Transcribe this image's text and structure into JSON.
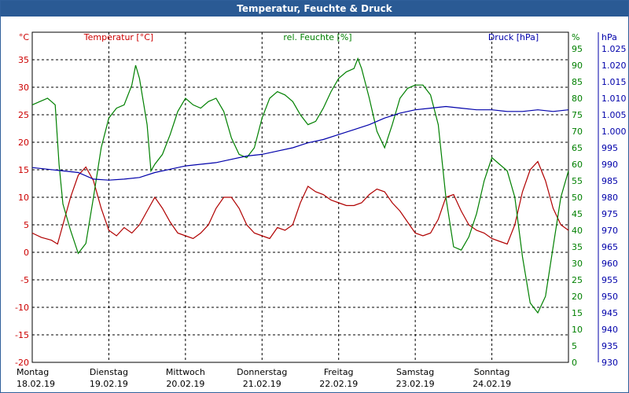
{
  "window": {
    "title": "Temperatur, Feuchte & Druck"
  },
  "chart_data": {
    "type": "line",
    "title": "Temperatur, Feuchte & Druck",
    "axes": {
      "left": {
        "unit": "°C",
        "label": "Temperatur [°C]",
        "range": [
          -20,
          40
        ],
        "ticks": [
          -20,
          -15,
          -10,
          -5,
          0,
          5,
          10,
          15,
          20,
          25,
          30,
          35
        ],
        "color": "#cc0000"
      },
      "right1": {
        "unit": "%",
        "label": "rel. Feuchte [%]",
        "range": [
          0,
          100
        ],
        "ticks": [
          0,
          5,
          10,
          15,
          20,
          25,
          30,
          35,
          40,
          45,
          50,
          55,
          60,
          65,
          70,
          75,
          80,
          85,
          90,
          95
        ],
        "color": "#008000"
      },
      "right2": {
        "unit": "hPa",
        "label": "Druck [hPa]",
        "range": [
          930,
          1030
        ],
        "ticks": [
          "930",
          "935",
          "940",
          "945",
          "950",
          "955",
          "960",
          "965",
          "970",
          "975",
          "980",
          "985",
          "990",
          "995",
          "1.000",
          "1.005",
          "1.010",
          "1.015",
          "1.020",
          "1.025"
        ],
        "color": "#0000aa"
      }
    },
    "x": {
      "range": [
        0,
        7
      ],
      "ticks": [
        {
          "day": "Montag",
          "date": "18.02.19"
        },
        {
          "day": "Dienstag",
          "date": "19.02.19"
        },
        {
          "day": "Mittwoch",
          "date": "20.02.19"
        },
        {
          "day": "Donnerstag",
          "date": "21.02.19"
        },
        {
          "day": "Freitag",
          "date": "22.02.19"
        },
        {
          "day": "Samstag",
          "date": "23.02.19"
        },
        {
          "day": "Sonntag",
          "date": "24.02.19"
        }
      ]
    },
    "grid": true,
    "series": [
      {
        "name": "Temperatur [°C]",
        "axis": "left",
        "color": "#b00000",
        "points": [
          [
            0.0,
            3.5
          ],
          [
            0.12,
            2.7
          ],
          [
            0.25,
            2.2
          ],
          [
            0.33,
            1.5
          ],
          [
            0.4,
            5.0
          ],
          [
            0.5,
            10.0
          ],
          [
            0.6,
            14.0
          ],
          [
            0.7,
            15.5
          ],
          [
            0.8,
            13.0
          ],
          [
            0.9,
            8.0
          ],
          [
            1.0,
            4.0
          ],
          [
            1.1,
            3.0
          ],
          [
            1.2,
            4.5
          ],
          [
            1.3,
            3.5
          ],
          [
            1.4,
            5.0
          ],
          [
            1.5,
            7.5
          ],
          [
            1.6,
            10.0
          ],
          [
            1.7,
            8.0
          ],
          [
            1.8,
            5.5
          ],
          [
            1.9,
            3.5
          ],
          [
            2.0,
            3.0
          ],
          [
            2.1,
            2.5
          ],
          [
            2.2,
            3.5
          ],
          [
            2.3,
            5.0
          ],
          [
            2.4,
            8.0
          ],
          [
            2.5,
            10.0
          ],
          [
            2.6,
            10.0
          ],
          [
            2.7,
            8.0
          ],
          [
            2.8,
            5.0
          ],
          [
            2.9,
            3.5
          ],
          [
            3.0,
            3.0
          ],
          [
            3.1,
            2.5
          ],
          [
            3.2,
            4.5
          ],
          [
            3.3,
            4.0
          ],
          [
            3.4,
            5.0
          ],
          [
            3.5,
            9.0
          ],
          [
            3.6,
            12.0
          ],
          [
            3.7,
            11.0
          ],
          [
            3.8,
            10.5
          ],
          [
            3.9,
            9.5
          ],
          [
            4.0,
            9.0
          ],
          [
            4.1,
            8.5
          ],
          [
            4.2,
            8.5
          ],
          [
            4.3,
            9.0
          ],
          [
            4.4,
            10.5
          ],
          [
            4.5,
            11.5
          ],
          [
            4.6,
            11.0
          ],
          [
            4.7,
            9.0
          ],
          [
            4.8,
            7.5
          ],
          [
            4.9,
            5.5
          ],
          [
            5.0,
            3.5
          ],
          [
            5.1,
            3.0
          ],
          [
            5.2,
            3.5
          ],
          [
            5.3,
            6.0
          ],
          [
            5.4,
            10.0
          ],
          [
            5.5,
            10.5
          ],
          [
            5.6,
            7.5
          ],
          [
            5.7,
            5.0
          ],
          [
            5.8,
            4.0
          ],
          [
            5.9,
            3.5
          ],
          [
            6.0,
            2.5
          ],
          [
            6.1,
            2.0
          ],
          [
            6.2,
            1.5
          ],
          [
            6.3,
            5.0
          ],
          [
            6.4,
            11.0
          ],
          [
            6.5,
            15.0
          ],
          [
            6.6,
            16.5
          ],
          [
            6.7,
            13.0
          ],
          [
            6.8,
            8.0
          ],
          [
            6.9,
            5.0
          ],
          [
            7.0,
            4.0
          ]
        ]
      },
      {
        "name": "rel. Feuchte [%]",
        "axis": "right1",
        "color": "#008000",
        "points": [
          [
            0.0,
            78
          ],
          [
            0.1,
            79
          ],
          [
            0.2,
            80
          ],
          [
            0.25,
            79
          ],
          [
            0.3,
            78
          ],
          [
            0.35,
            60
          ],
          [
            0.4,
            48
          ],
          [
            0.5,
            40
          ],
          [
            0.6,
            33
          ],
          [
            0.7,
            36
          ],
          [
            0.8,
            50
          ],
          [
            0.9,
            65
          ],
          [
            1.0,
            74
          ],
          [
            1.1,
            77
          ],
          [
            1.2,
            78
          ],
          [
            1.3,
            84
          ],
          [
            1.35,
            90
          ],
          [
            1.4,
            86
          ],
          [
            1.5,
            72
          ],
          [
            1.55,
            58
          ],
          [
            1.6,
            60
          ],
          [
            1.7,
            63
          ],
          [
            1.8,
            69
          ],
          [
            1.9,
            76
          ],
          [
            2.0,
            80
          ],
          [
            2.1,
            78
          ],
          [
            2.2,
            77
          ],
          [
            2.3,
            79
          ],
          [
            2.4,
            80
          ],
          [
            2.5,
            76
          ],
          [
            2.6,
            68
          ],
          [
            2.7,
            63
          ],
          [
            2.8,
            62
          ],
          [
            2.9,
            65
          ],
          [
            3.0,
            74
          ],
          [
            3.1,
            80
          ],
          [
            3.2,
            82
          ],
          [
            3.3,
            81
          ],
          [
            3.4,
            79
          ],
          [
            3.5,
            75
          ],
          [
            3.6,
            72
          ],
          [
            3.7,
            73
          ],
          [
            3.8,
            77
          ],
          [
            3.9,
            82
          ],
          [
            4.0,
            86
          ],
          [
            4.1,
            88
          ],
          [
            4.2,
            89
          ],
          [
            4.25,
            92
          ],
          [
            4.3,
            89
          ],
          [
            4.4,
            80
          ],
          [
            4.5,
            70
          ],
          [
            4.6,
            65
          ],
          [
            4.7,
            72
          ],
          [
            4.8,
            80
          ],
          [
            4.9,
            83
          ],
          [
            5.0,
            84
          ],
          [
            5.1,
            84
          ],
          [
            5.2,
            81
          ],
          [
            5.3,
            72
          ],
          [
            5.4,
            50
          ],
          [
            5.5,
            35
          ],
          [
            5.6,
            34
          ],
          [
            5.7,
            38
          ],
          [
            5.8,
            45
          ],
          [
            5.9,
            55
          ],
          [
            6.0,
            62
          ],
          [
            6.1,
            60
          ],
          [
            6.2,
            58
          ],
          [
            6.3,
            50
          ],
          [
            6.4,
            32
          ],
          [
            6.5,
            18
          ],
          [
            6.6,
            15
          ],
          [
            6.7,
            20
          ],
          [
            6.8,
            35
          ],
          [
            6.9,
            50
          ],
          [
            7.0,
            58
          ]
        ]
      },
      {
        "name": "Druck [hPa]",
        "axis": "right2",
        "color": "#0000aa",
        "points": [
          [
            0.0,
            989.0
          ],
          [
            0.2,
            988.5
          ],
          [
            0.4,
            988.0
          ],
          [
            0.6,
            987.5
          ],
          [
            0.8,
            985.5
          ],
          [
            1.0,
            985.2
          ],
          [
            1.2,
            985.5
          ],
          [
            1.4,
            986.0
          ],
          [
            1.6,
            987.5
          ],
          [
            1.8,
            988.5
          ],
          [
            2.0,
            989.5
          ],
          [
            2.2,
            990.0
          ],
          [
            2.4,
            990.5
          ],
          [
            2.6,
            991.5
          ],
          [
            2.8,
            992.5
          ],
          [
            3.0,
            993.0
          ],
          [
            3.2,
            994.0
          ],
          [
            3.4,
            995.0
          ],
          [
            3.6,
            996.5
          ],
          [
            3.8,
            997.5
          ],
          [
            4.0,
            999.0
          ],
          [
            4.2,
            1000.5
          ],
          [
            4.4,
            1002.0
          ],
          [
            4.6,
            1004.0
          ],
          [
            4.8,
            1005.5
          ],
          [
            5.0,
            1006.5
          ],
          [
            5.2,
            1007.0
          ],
          [
            5.4,
            1007.5
          ],
          [
            5.6,
            1007.0
          ],
          [
            5.8,
            1006.5
          ],
          [
            6.0,
            1006.5
          ],
          [
            6.2,
            1006.0
          ],
          [
            6.4,
            1006.0
          ],
          [
            6.6,
            1006.5
          ],
          [
            6.8,
            1006.0
          ],
          [
            7.0,
            1006.5
          ]
        ]
      }
    ]
  }
}
